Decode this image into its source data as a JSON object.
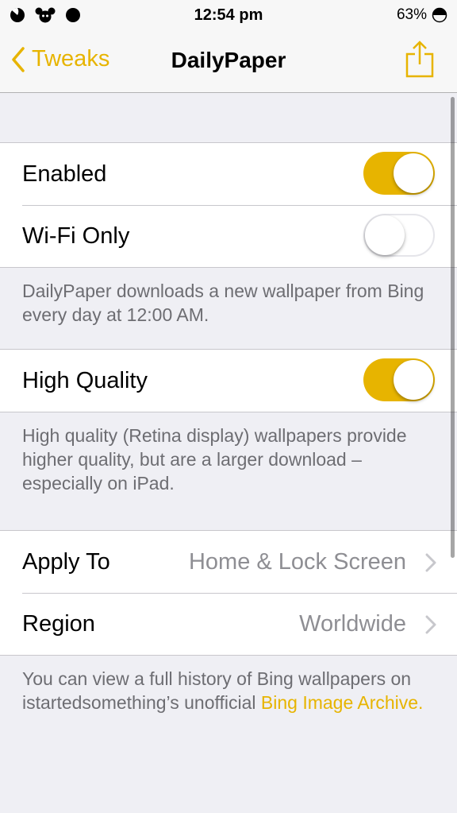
{
  "status": {
    "time": "12:54 pm",
    "battery": "63%"
  },
  "nav": {
    "back_label": "Tweaks",
    "title": "DailyPaper"
  },
  "settings": {
    "enabled": {
      "label": "Enabled",
      "on": true
    },
    "wifi_only": {
      "label": "Wi-Fi Only",
      "on": false
    },
    "download_note": "DailyPaper downloads a new wallpaper from Bing every day at 12:00 AM.",
    "high_quality": {
      "label": "High Quality",
      "on": true
    },
    "quality_note": "High quality (Retina display) wallpapers provide higher quality, but are a larger download – especially on iPad.",
    "apply_to": {
      "label": "Apply To",
      "value": "Home & Lock Screen"
    },
    "region": {
      "label": "Region",
      "value": "Worldwide"
    },
    "history_note": "You can view a full history of Bing wallpapers on istartedsomething’s unofficial",
    "archive_link": "Bing Image Archive."
  },
  "colors": {
    "accent": "#e7b400",
    "background": "#efeff4"
  }
}
